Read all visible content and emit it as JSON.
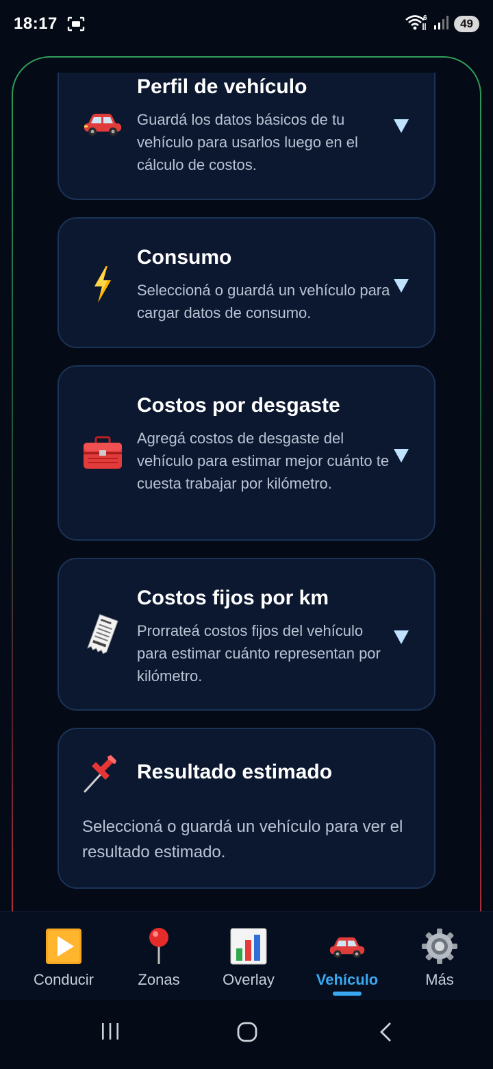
{
  "status_bar": {
    "time": "18:17",
    "wifi_badge": "6",
    "battery": "49"
  },
  "cards": [
    {
      "title": "Perfil de vehículo",
      "description": "Guardá los datos básicos de tu vehículo para usarlos luego en el cálculo de costos.",
      "icon": "car-icon"
    },
    {
      "title": "Consumo",
      "description": "Seleccioná o guardá un vehículo para cargar datos de consumo.",
      "icon": "lightning-icon"
    },
    {
      "title": "Costos por desgaste",
      "description": "Agregá costos de desgaste del vehículo para estimar mejor cuánto te cuesta trabajar por kilómetro.",
      "icon": "toolbox-icon"
    },
    {
      "title": "Costos fijos por km",
      "description": "Prorrateá costos fijos del vehículo para estimar cuánto representan por kilómetro.",
      "icon": "receipt-icon"
    }
  ],
  "result_card": {
    "title": "Resultado estimado",
    "description": "Seleccioná o guardá un vehículo para ver el resultado estimado.",
    "icon": "pushpin-icon"
  },
  "bottom_nav": {
    "items": [
      {
        "label": "Conducir",
        "icon": "play-icon"
      },
      {
        "label": "Zonas",
        "icon": "map-pin-icon"
      },
      {
        "label": "Overlay",
        "icon": "bar-chart-icon"
      },
      {
        "label": "Vehículo",
        "icon": "car-icon",
        "active": true
      },
      {
        "label": "Más",
        "icon": "gear-icon"
      }
    ]
  },
  "colors": {
    "background": "#050b16",
    "card": "#0c1830",
    "accent": "#3aa8f0",
    "chevron": "#bfe3ff"
  }
}
